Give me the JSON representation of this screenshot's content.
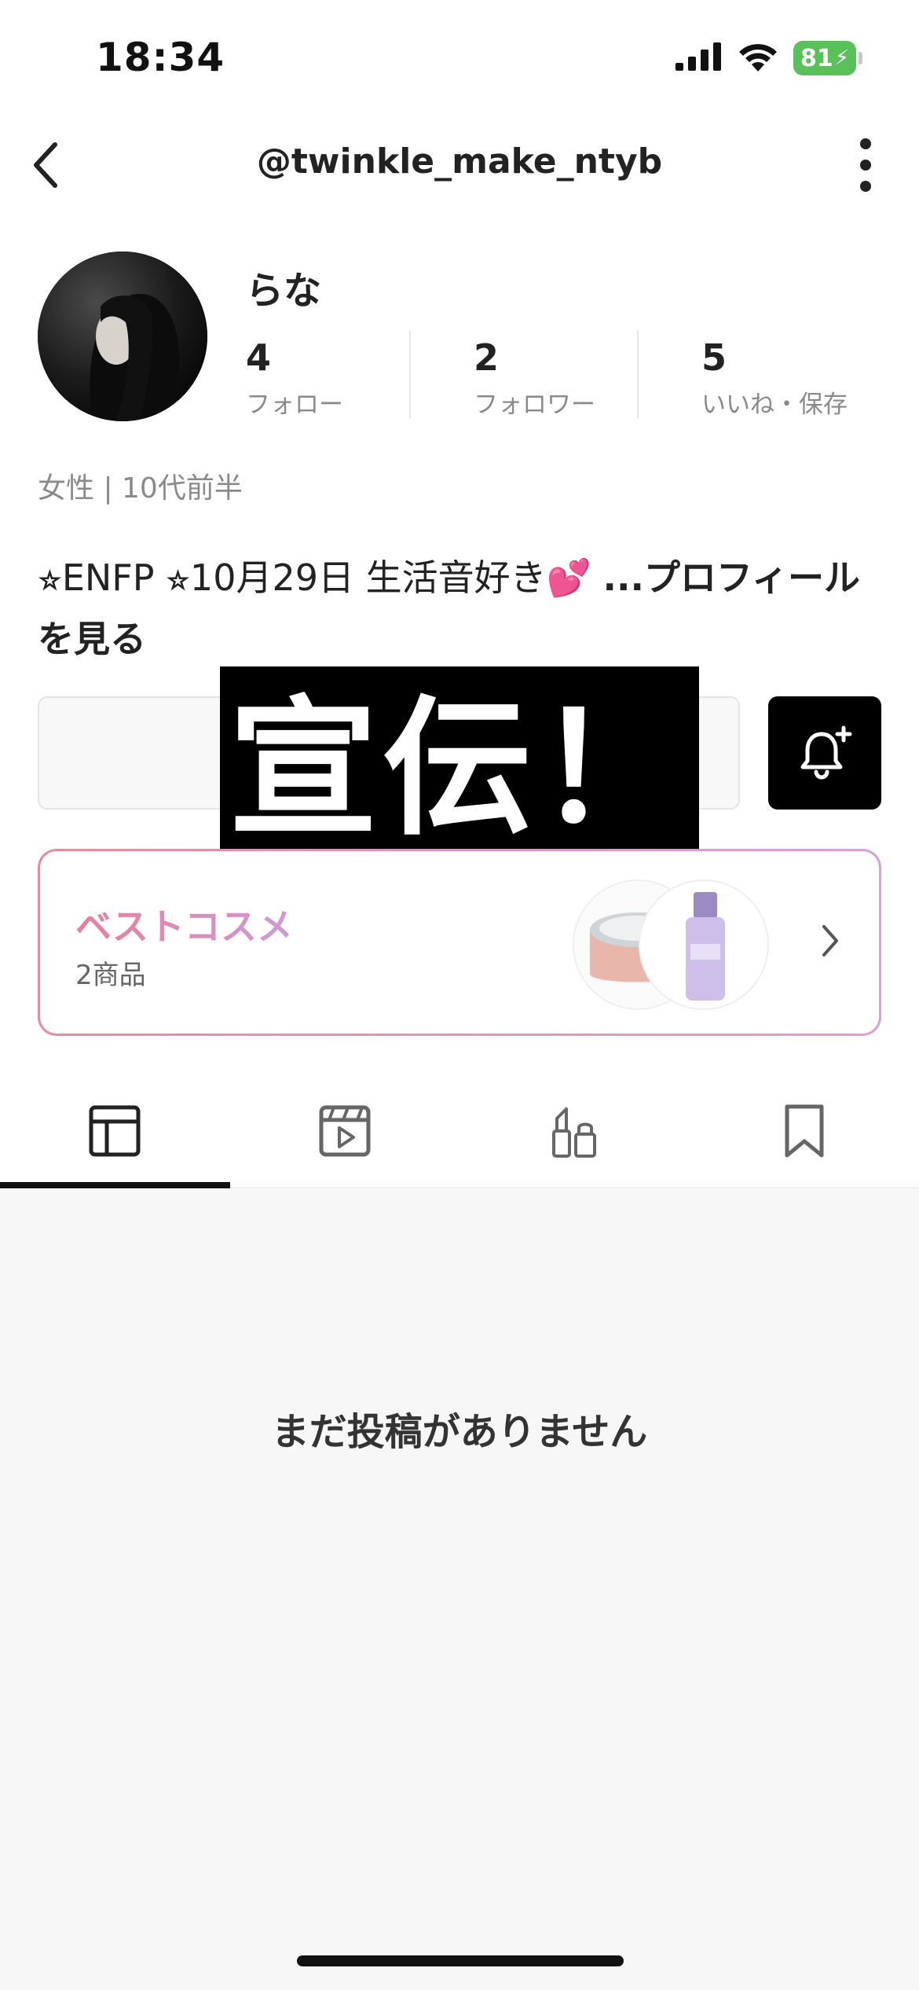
{
  "status_bar": {
    "time": "18:34",
    "battery": "81",
    "icons": [
      "signal-icon",
      "wifi-icon",
      "battery-icon",
      "charging-bolt-icon"
    ]
  },
  "header": {
    "title": "@twinkle_make_ntyb",
    "icons": [
      "back-chevron-icon",
      "more-vertical-icon"
    ]
  },
  "profile": {
    "name": "らな",
    "stats": [
      {
        "value": "4",
        "label": "フォロー"
      },
      {
        "value": "2",
        "label": "フォロワー"
      },
      {
        "value": "5",
        "label": "いいね・保存"
      }
    ],
    "demographic": "女性 | 10代前半",
    "bio_text": "⭐︎ENFP ⭐︎10月29日 生活音好き💕 ",
    "bio_more": "...プロフィールを見る"
  },
  "promo_overlay": "宣伝！",
  "best_cosme": {
    "title": "ベストコスメ",
    "count": "2商品",
    "icons": [
      "cosmetic-jar-thumb",
      "serum-bottle-thumb",
      "chevron-right-icon"
    ]
  },
  "tabs": [
    {
      "name": "posts-tab",
      "icon": "grid-layout-icon",
      "active": true
    },
    {
      "name": "videos-tab",
      "icon": "video-play-icon",
      "active": false
    },
    {
      "name": "cosmetics-tab",
      "icon": "lipstick-icon",
      "active": false
    },
    {
      "name": "saved-tab",
      "icon": "bookmark-icon",
      "active": false
    }
  ],
  "empty_state": "まだ投稿がありません",
  "colors": {
    "battery": "#5ac05a",
    "best_gradient_start": "#e77f9a",
    "best_gradient_end": "#cf9ad8",
    "notify_button": "#000000"
  }
}
